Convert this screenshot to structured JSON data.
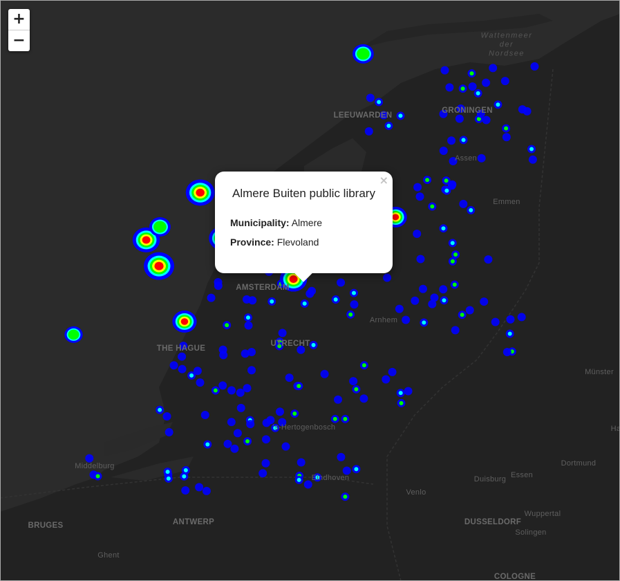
{
  "zoom": {
    "in": "+",
    "out": "−"
  },
  "popup": {
    "title": "Almere Buiten public library",
    "municipality_label": "Municipality:",
    "municipality": "Almere",
    "province_label": "Province:",
    "province": "Flevoland",
    "close": "×"
  },
  "labels": {
    "wadden1": "Wattenmeer",
    "wadden2": "der",
    "wadden3": "Nordsee",
    "leeuwarden": "LEEUWARDEN",
    "groningen": "GRONINGEN",
    "assen": "Assen",
    "emmen": "Emmen",
    "amsterdam": "AMSTERDAM",
    "hague": "THE HAGUE",
    "utrecht": "UTRECHT",
    "arnhem": "Arnhem",
    "hertogenbosch": "'s-Hertogenbosch",
    "middelburg": "Middelburg",
    "eindhoven": "Eindhoven",
    "venlo": "Venlo",
    "munster": "Münster",
    "dortmund": "Dortmund",
    "essen": "Essen",
    "duisburg": "Duisburg",
    "dusseldorf": "DUSSELDORF",
    "wuppertal": "Wuppertal",
    "solingen": "Solingen",
    "cologne": "COLOGNE",
    "bruges": "BRUGES",
    "antwerp": "ANTWERP",
    "ghent": "Ghent",
    "ha": "Ha"
  },
  "heat": {
    "description": "library locations",
    "colors": {
      "low": "#0000ff",
      "mid": "#00ffff",
      "green": "#00ff00",
      "yellow": "#ffff00",
      "high": "#ff0000"
    },
    "clusters": [
      {
        "lon": 5.24,
        "lat": 52.37,
        "w": 1.0
      },
      {
        "lon": 4.9,
        "lat": 52.37,
        "w": 0.95
      },
      {
        "lon": 4.35,
        "lat": 52.08,
        "w": 0.9
      },
      {
        "lon": 4.48,
        "lat": 51.92,
        "w": 1.0
      },
      {
        "lon": 5.12,
        "lat": 52.09,
        "w": 0.85
      },
      {
        "lon": 5.91,
        "lat": 51.98,
        "w": 0.95
      },
      {
        "lon": 5.85,
        "lat": 51.84,
        "w": 0.9
      },
      {
        "lon": 6.09,
        "lat": 52.22,
        "w": 1.0
      },
      {
        "lon": 6.89,
        "lat": 52.22,
        "w": 0.75
      },
      {
        "lon": 6.56,
        "lat": 53.22,
        "w": 0.7
      },
      {
        "lon": 4.74,
        "lat": 51.58,
        "w": 0.8
      },
      {
        "lon": 3.61,
        "lat": 51.5,
        "w": 0.6
      },
      {
        "lon": 4.49,
        "lat": 52.16,
        "w": 0.7
      }
    ]
  }
}
